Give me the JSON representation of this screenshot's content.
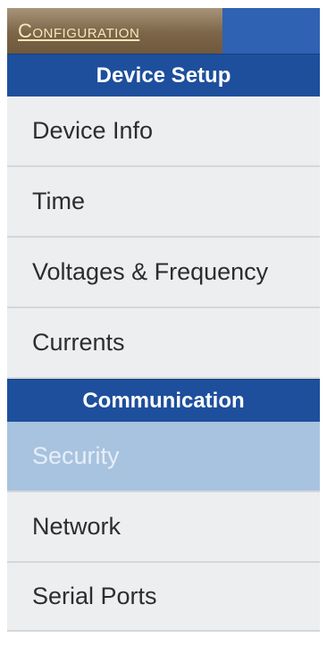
{
  "header": {
    "config_label": "Configuration"
  },
  "sections": [
    {
      "title": "Device Setup",
      "items": [
        {
          "label": "Device Info",
          "selected": false
        },
        {
          "label": "Time",
          "selected": false
        },
        {
          "label": "Voltages & Frequency",
          "selected": false
        },
        {
          "label": "Currents",
          "selected": false
        }
      ]
    },
    {
      "title": "Communication",
      "items": [
        {
          "label": "Security",
          "selected": true
        },
        {
          "label": "Network",
          "selected": false
        },
        {
          "label": "Serial Ports",
          "selected": false
        }
      ]
    }
  ],
  "colors": {
    "section_header": "#1e4f9d",
    "selected_item": "#a8c3df",
    "item_background": "#eceeef",
    "config_tab_text": "#f7e7b8"
  }
}
